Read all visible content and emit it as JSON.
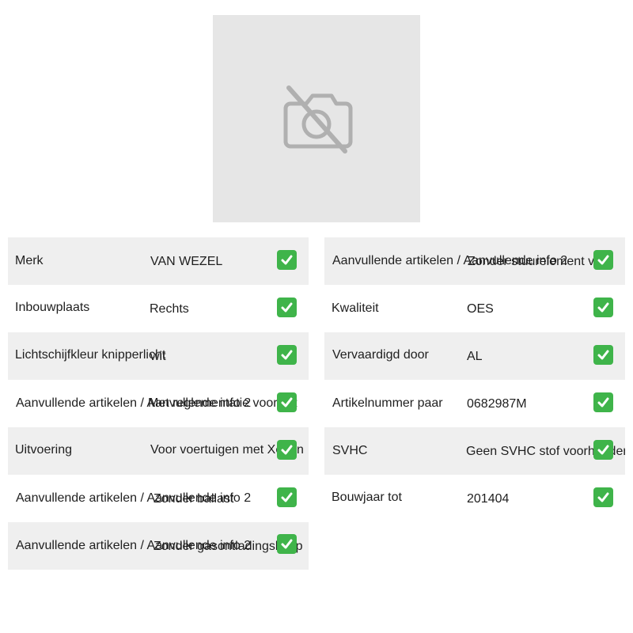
{
  "product_image": {
    "icon": "camera-off-icon",
    "background": "#e6e6e6"
  },
  "specs": {
    "left": [
      {
        "label": "Merk",
        "value": "VAN WEZEL",
        "check": "check-icon"
      },
      {
        "label": "Inbouwplaats",
        "value": "Rechts",
        "check": "check-icon"
      },
      {
        "label": "Lichtschijfkleur knipperlicht",
        "value": "wit",
        "check": "check-icon"
      },
      {
        "label": "Aanvullende artikelen / Aanvullende info 2",
        "value": "Met reglementatie voor AR",
        "check": "check-icon"
      },
      {
        "label": "Uitvoering",
        "value": "Voor voertuigen met Xenon",
        "check": "check-icon"
      },
      {
        "label": "Aanvullende artikelen / Aanvullende info 2",
        "value": "Zonder ballast",
        "check": "check-icon"
      },
      {
        "label": "Aanvullende artikelen / Aanvullende info 2",
        "value": "Zonder gasontladingslamp",
        "check": "check-icon"
      }
    ],
    "right": [
      {
        "label": "Aanvullende artikelen / Aanvullende info 2",
        "value": "Zonder stuurelement voor",
        "check": "check-icon"
      },
      {
        "label": "Kwaliteit",
        "value": "OES",
        "check": "check-icon"
      },
      {
        "label": "Vervaardigd door",
        "value": "AL",
        "check": "check-icon"
      },
      {
        "label": "Artikelnummer paar",
        "value": "0682987M",
        "check": "check-icon"
      },
      {
        "label": "SVHC",
        "value": "Geen SVHC stof voorhanden",
        "check": "check-icon"
      },
      {
        "label": "Bouwjaar tot",
        "value": "201404",
        "check": "check-icon"
      }
    ]
  },
  "colors": {
    "row_shade": "#efefef",
    "check_green": "#3fb44a",
    "icon_gray": "#b0b0b0"
  }
}
